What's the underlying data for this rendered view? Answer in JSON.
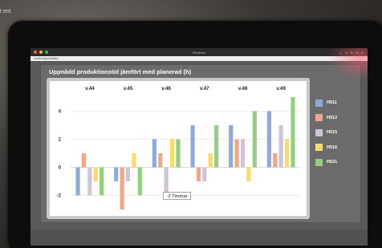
{
  "backdrop": {
    "text": "t ent"
  },
  "window": {
    "title": "Windows",
    "url": "localhost/produktion",
    "dot_colors": [
      "#ff5f57",
      "#febc2e",
      "#28c840"
    ]
  },
  "app": {
    "title": "Uppnådd produktionstid jämfört med planerad (h)"
  },
  "tooltip": {
    "text": "-2 Timmar"
  },
  "chart_data": {
    "type": "bar",
    "categories": [
      "v.44",
      "v.45",
      "v.46",
      "v.47",
      "v.48",
      "v.49"
    ],
    "ylim": [
      -3,
      5
    ],
    "yticks": [
      -2,
      0,
      2,
      4
    ],
    "grid": true,
    "legend_position": "right",
    "series": [
      {
        "name": "H511",
        "color": "#8eaadb",
        "values": [
          -2,
          -1,
          2,
          3,
          3,
          4
        ]
      },
      {
        "name": "H512",
        "color": "#f4a582",
        "values": [
          1,
          -3,
          1,
          -1,
          2,
          1
        ]
      },
      {
        "name": "H515",
        "color": "#cfc3d6",
        "values": [
          -2,
          -1,
          -2,
          -1,
          2,
          3
        ]
      },
      {
        "name": "H516",
        "color": "#ffd966",
        "values": [
          -1,
          1,
          2,
          1,
          -1,
          2
        ]
      },
      {
        "name": "H521",
        "color": "#93d07d",
        "values": [
          -2,
          -2,
          2,
          3,
          4,
          5
        ]
      }
    ]
  }
}
